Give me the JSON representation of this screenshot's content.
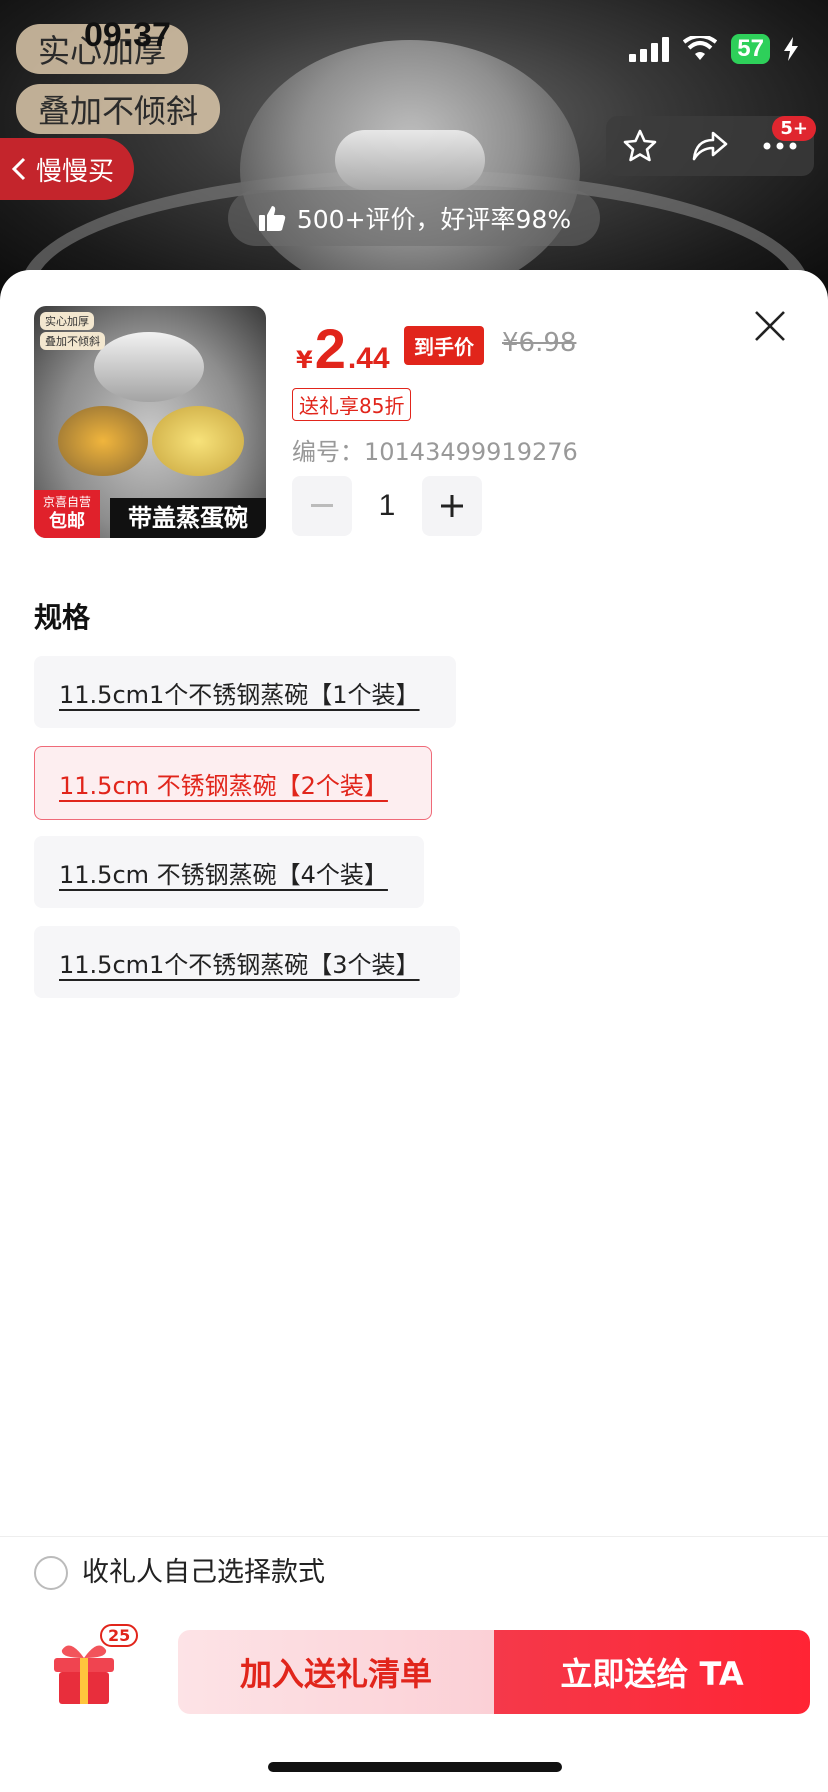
{
  "status_bar": {
    "time": "09:37",
    "battery": "57"
  },
  "hero": {
    "tag_line1": "实心加厚",
    "tag_line2": "叠加不倾斜",
    "back_label": "慢慢买",
    "more_badge": "5+",
    "rating_text": "500+评价，好评率98%"
  },
  "product": {
    "thumb_tag1": "实心加厚",
    "thumb_tag2": "叠加不倾斜",
    "thumb_jd_top": "京喜自营",
    "thumb_jd_bottom": "包邮",
    "thumb_caption": "带盖蒸蛋碗",
    "currency": "¥",
    "price_int": "2",
    "price_dec": ".44",
    "price_tag": "到手价",
    "original_price": "¥6.98",
    "coupon": "送礼享85折",
    "sku": "编号：10143499919276",
    "quantity": "1"
  },
  "spec": {
    "title": "规格",
    "options": [
      {
        "label": "11.5cm1个不锈钢蒸碗【1个装】",
        "selected": false
      },
      {
        "label": "11.5cm 不锈钢蒸碗【2个装】",
        "selected": true
      },
      {
        "label": "11.5cm 不锈钢蒸碗【4个装】",
        "selected": false
      },
      {
        "label": "11.5cm1个不锈钢蒸碗【3个装】",
        "selected": false
      }
    ]
  },
  "footer": {
    "radio_label": "收礼人自己选择款式",
    "gift_count": "25",
    "add_button": "加入送礼清单",
    "send_button": "立即送给 TA"
  },
  "colors": {
    "accent": "#e1251b",
    "selected_bg": "#fdeef0"
  }
}
